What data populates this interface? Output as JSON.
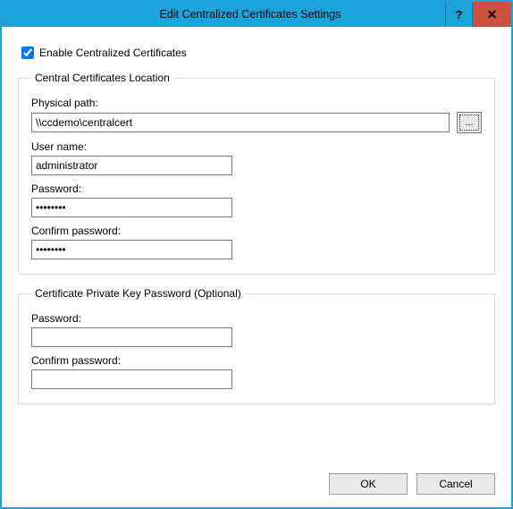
{
  "titlebar": {
    "title": "Edit Centralized Certificates Settings",
    "help": "?",
    "close": "✕"
  },
  "enable": {
    "label": "Enable Centralized Certificates",
    "checked": true
  },
  "group_location": {
    "legend": "Central Certificates Location",
    "physical_path_label": "Physical path:",
    "physical_path_value": "\\\\ccdemo\\centralcert",
    "browse_label": "...",
    "username_label": "User name:",
    "username_value": "administrator",
    "password_label": "Password:",
    "password_value": "••••••••",
    "confirm_label": "Confirm password:",
    "confirm_value": "••••••••"
  },
  "group_pk": {
    "legend": "Certificate Private Key Password (Optional)",
    "password_label": "Password:",
    "password_value": "",
    "confirm_label": "Confirm password:",
    "confirm_value": ""
  },
  "footer": {
    "ok": "OK",
    "cancel": "Cancel"
  }
}
